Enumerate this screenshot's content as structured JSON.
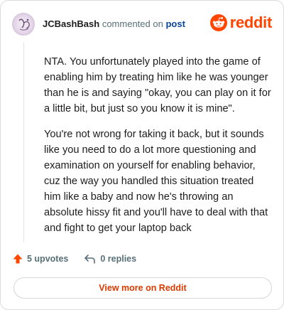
{
  "comment": {
    "author": "JCBashBash",
    "action_text": "commented on",
    "target_link": "post",
    "paragraphs": [
      "NTA. You unfortunately played into the game of enabling him by treating him like he was younger than he is and saying \"okay, you can play on it for a little bit, but just so you know it is mine\".",
      "You're not wrong for taking it back, but it sounds like you need to do a lot more questioning and examination on yourself for enabling behavior, cuz the way you handled this situation treated him like a baby and now he's throwing an absolute hissy fit and you'll have to deal with that and fight to get your laptop back"
    ]
  },
  "brand": {
    "name": "reddit",
    "icon": "reddit-snoo-icon",
    "color": "#ff4500"
  },
  "actions": {
    "upvotes": "5 upvotes",
    "upvote_icon": "upvote-arrow-icon",
    "upvote_color": "#ff4500",
    "replies": "0 replies",
    "reply_icon": "reply-arrow-icon"
  },
  "footer": {
    "view_more_label": "View more on Reddit",
    "accent": "#d93a00"
  }
}
